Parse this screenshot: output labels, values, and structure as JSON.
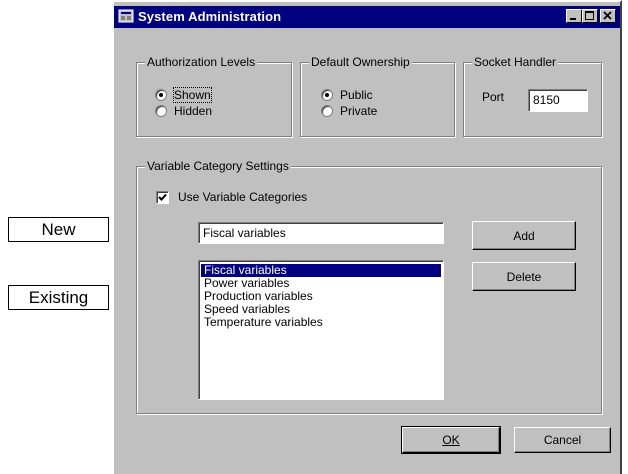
{
  "window": {
    "title": "System Administration",
    "buttons": [
      "minimize",
      "maximize",
      "close"
    ]
  },
  "authorization": {
    "label": "Authorization Levels",
    "options": [
      {
        "label": "Shown",
        "selected": true
      },
      {
        "label": "Hidden",
        "selected": false
      }
    ]
  },
  "ownership": {
    "label": "Default Ownership",
    "options": [
      {
        "label": "Public",
        "selected": true
      },
      {
        "label": "Private",
        "selected": false
      }
    ]
  },
  "socket": {
    "label": "Socket Handler",
    "port_label": "Port",
    "port_value": "8150"
  },
  "categories": {
    "label": "Variable Category Settings",
    "use_label": "Use Variable Categories",
    "use_checked": true,
    "new_value": "Fiscal variables",
    "add_label": "Add",
    "delete_label": "Delete",
    "items": [
      {
        "label": "Fiscal variables",
        "selected": true
      },
      {
        "label": "Power variables",
        "selected": false
      },
      {
        "label": "Production variables",
        "selected": false
      },
      {
        "label": "Speed variables",
        "selected": false
      },
      {
        "label": "Temperature variables",
        "selected": false
      }
    ]
  },
  "footer": {
    "ok_label": "OK",
    "cancel_label": "Cancel"
  },
  "callouts": {
    "new_label": "New",
    "existing_label": "Existing"
  }
}
